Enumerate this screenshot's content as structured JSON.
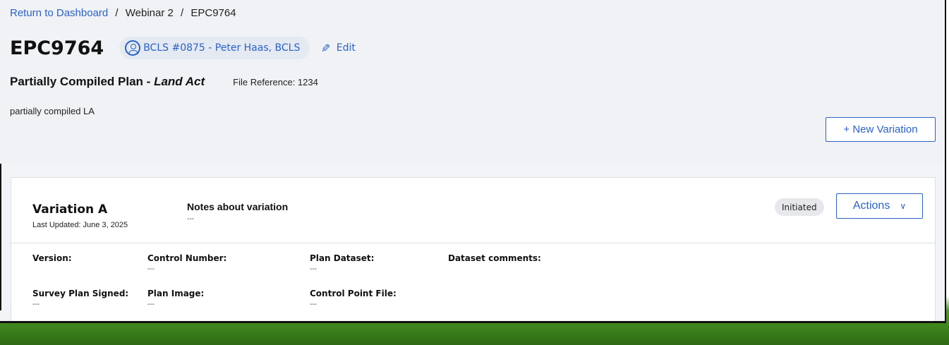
{
  "breadcrumb": {
    "link": "Return to Dashboard",
    "separator": "/",
    "item1": "Webinar 2",
    "item2": "EPC9764"
  },
  "plan": {
    "id": "EPC9764",
    "surveyor": "BCLS #0875 - Peter Haas, BCLS",
    "edit_label": "Edit",
    "type_prefix": "Partially Compiled Plan - ",
    "type_act": "Land Act",
    "file_reference": "File Reference: 1234",
    "description": "partially compiled LA",
    "new_variation_label": "+ New Variation"
  },
  "variation": {
    "name": "Variation A",
    "last_updated": "Last Updated: June 3, 2025",
    "notes_label": "Notes about variation",
    "notes_value": "---",
    "status": "Initiated",
    "actions_label": "Actions",
    "fields": {
      "version": {
        "label": "Version:",
        "value": ""
      },
      "control_number": {
        "label": "Control Number:",
        "value": "---"
      },
      "plan_dataset": {
        "label": "Plan Dataset:",
        "value": "---"
      },
      "dataset_comments": {
        "label": "Dataset comments:",
        "value": ""
      },
      "survey_plan_signed": {
        "label": "Survey Plan Signed:",
        "value": "---"
      },
      "plan_image": {
        "label": "Plan Image:",
        "value": "---"
      },
      "control_point_file": {
        "label": "Control Point File:",
        "value": "---"
      }
    }
  },
  "icons": {
    "surveyor": "person-circle-icon",
    "edit": "pencil-icon",
    "actions": "chevron-down-icon"
  },
  "colors": {
    "accent": "#2a63c4",
    "header_bg": "#f0f2f5",
    "badge_bg": "#e6e8eb"
  }
}
